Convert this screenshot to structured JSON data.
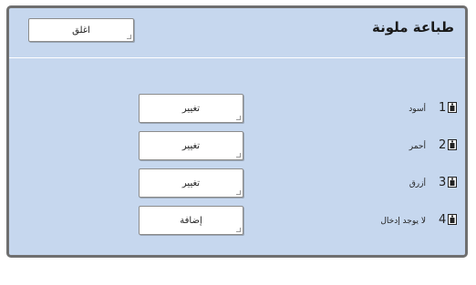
{
  "window": {
    "title": "طباعة ملونة"
  },
  "close_button": {
    "label": "اغلق"
  },
  "rows": [
    {
      "number": "1",
      "icon": "ink-cartridge-icon",
      "color_name": "أسود",
      "action": "تغيير"
    },
    {
      "number": "2",
      "icon": "ink-cartridge-icon",
      "color_name": "أحمر",
      "action": "تغيير"
    },
    {
      "number": "3",
      "icon": "ink-cartridge-icon",
      "color_name": "أزرق",
      "action": "تغيير"
    },
    {
      "number": "4",
      "icon": "ink-cartridge-icon",
      "color_name": "لا يوجد إدخال",
      "action": "إضافة"
    }
  ],
  "colors": {
    "panel_bg": "#c6d7ee",
    "frame_border": "#6f6f6f",
    "button_bg": "#ffffff"
  }
}
